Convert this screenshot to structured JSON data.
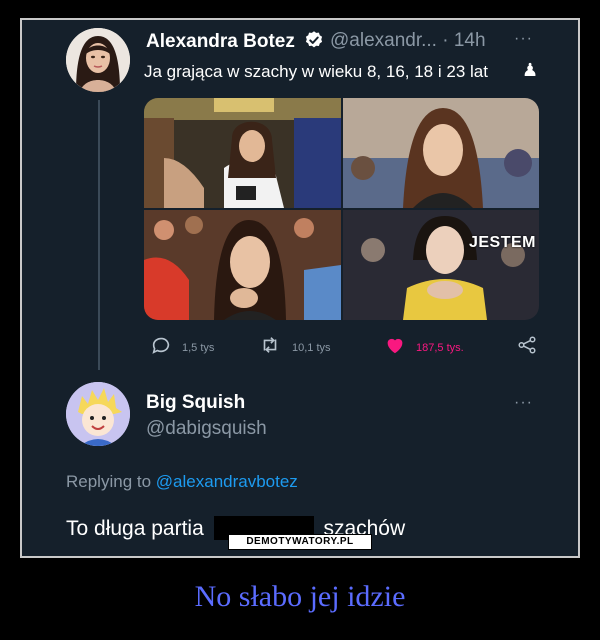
{
  "tweet": {
    "author_name": "Alexandra Botez",
    "author_handle": "@alexandr...",
    "time": "· 14h",
    "more_icon": "···",
    "text": "Ja grająca w szachy w wieku 8, 16, 18 i 23 lat",
    "emoji": "♟",
    "photo_overlay_text": "JESTEM",
    "replies": "1,5 tys",
    "retweets": "10,1 tys",
    "likes": "187,5 tys.",
    "like_color": "#f91880"
  },
  "reply": {
    "author_name": "Big Squish",
    "author_handle": "@dabigsquish",
    "more_icon": "···",
    "replying_prefix": "Replying to",
    "replying_mention": "@alexandravbotez",
    "text_before": "To długa partia",
    "text_after": "szachów"
  },
  "watermark": "DEMOTYWATORY.PL",
  "caption": "No słabo jej idzie",
  "colors": {
    "background": "#15202b",
    "accent": "#1d9bf0",
    "caption": "#5b6cff"
  }
}
